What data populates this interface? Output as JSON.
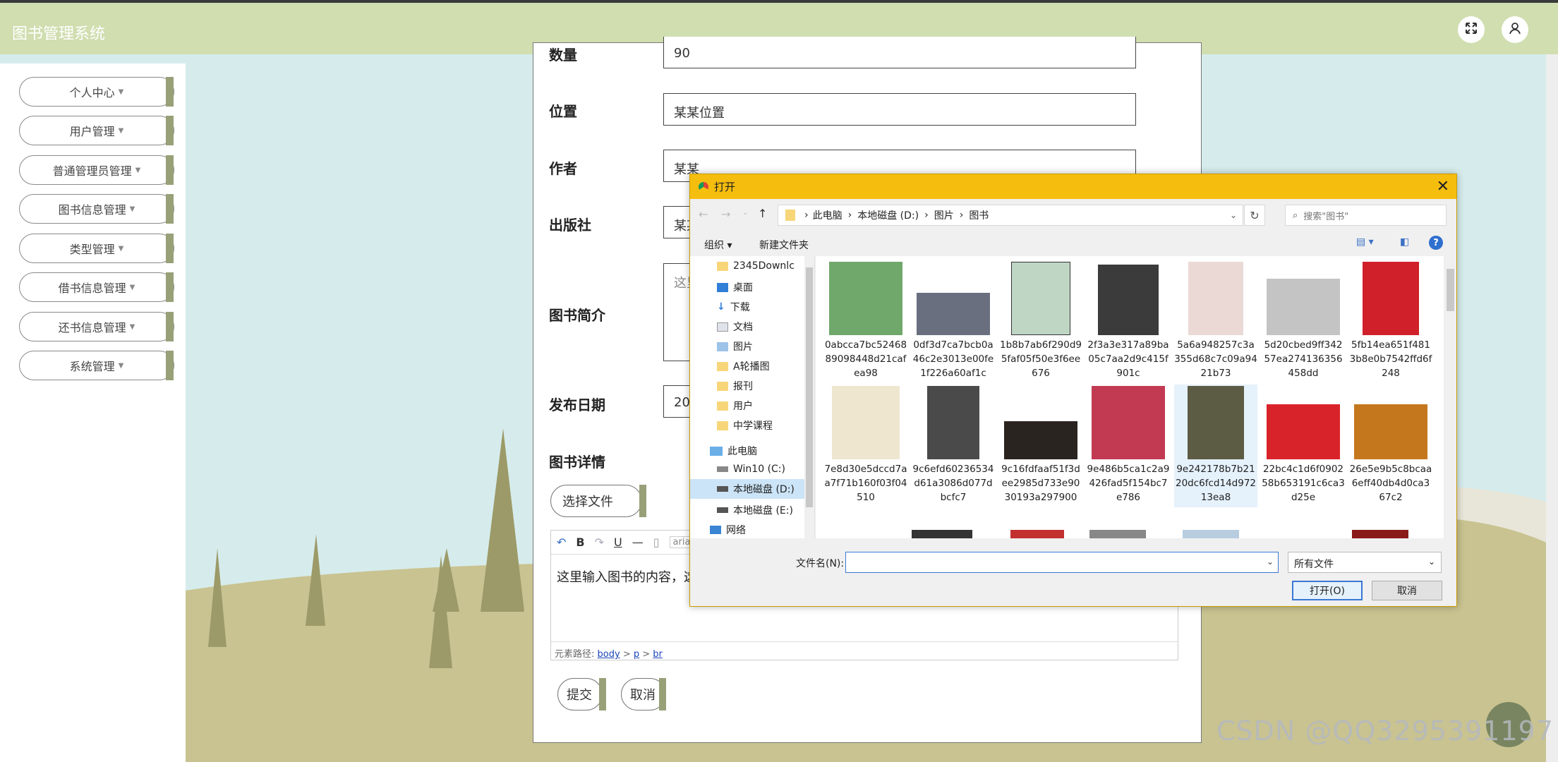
{
  "header": {
    "title": "图书管理系统"
  },
  "sidebar": {
    "items": [
      {
        "label": "个人中心"
      },
      {
        "label": "用户管理"
      },
      {
        "label": "普通管理员管理"
      },
      {
        "label": "图书信息管理"
      },
      {
        "label": "类型管理"
      },
      {
        "label": "借书信息管理"
      },
      {
        "label": "还书信息管理"
      },
      {
        "label": "系统管理"
      }
    ]
  },
  "form": {
    "quantity": {
      "label": "数量",
      "value": "90"
    },
    "location": {
      "label": "位置",
      "value": "某某位置"
    },
    "author": {
      "label": "作者",
      "value": "某某"
    },
    "publisher": {
      "label": "出版社",
      "value": "某某"
    },
    "intro": {
      "label": "图书简介",
      "value": "这里"
    },
    "publish_date": {
      "label": "发布日期",
      "value": "20"
    },
    "details": {
      "label": "图书详情"
    },
    "choose_file": "选择文件",
    "editor": {
      "font": "aria",
      "content": "这里输入图书的内容，这",
      "path_label": "元素路径:",
      "path": [
        "body",
        "p",
        "br"
      ]
    },
    "submit": "提交",
    "cancel": "取消"
  },
  "dialog": {
    "title": "打开",
    "breadcrumb": [
      "此电脑",
      "本地磁盘 (D:)",
      "图片",
      "图书"
    ],
    "search_placeholder": "搜索\"图书\"",
    "organize": "组织",
    "new_folder": "新建文件夹",
    "nav_items": [
      "2345Downlc",
      "桌面",
      "下载",
      "文档",
      "图片",
      "A轮播图",
      "报刊",
      "用户",
      "中学课程",
      "此电脑",
      "Win10 (C:)",
      "本地磁盘 (D:)",
      "本地磁盘 (E:)",
      "网络"
    ],
    "files": [
      {
        "name": "0abcca7bc5246889098448d21cafea98",
        "color": "#6fa86a"
      },
      {
        "name": "0df3d7ca7bcb0a46c2e3013e00fe1f226a60af1c",
        "color": "#6a6f80"
      },
      {
        "name": "1b8b7ab6f290d95faf05f50e3f6ee676",
        "color": "#bfd6c4"
      },
      {
        "name": "2f3a3e317a89ba05c7aa2d9c415f901c",
        "color": "#3b3b3b"
      },
      {
        "name": "5a6a948257c3a355d68c7c09a9421b73",
        "color": "#ead9d5"
      },
      {
        "name": "5d20cbed9ff34257ea274136356458dd",
        "color": "#c4c4c4"
      },
      {
        "name": "5fb14ea651f4813b8e0b7542ffd6f248",
        "color": "#d0202a"
      },
      {
        "name": "7e8d30e5dccd7aa7f71b160f03f04510",
        "color": "#efe6d0"
      },
      {
        "name": "9c6efd60236534d61a3086d077dbcfc7",
        "color": "#4a4a4a"
      },
      {
        "name": "9c16fdfaaf51f3dee2985d733e9030193a297900",
        "color": "#2a2420"
      },
      {
        "name": "9e486b5ca1c2a9426fad5f154bc7e786",
        "color": "#c23a52"
      },
      {
        "name": "9e242178b7b2120dc6fcd14d97213ea8",
        "color": "#5c5c44"
      },
      {
        "name": "22bc4c1d6f090258b653191c6ca3d25e",
        "color": "#d9232a"
      },
      {
        "name": "26e5e9b5c8bcaa6eff40db4d0ca367c2",
        "color": "#c5771e"
      }
    ],
    "filename_label": "文件名(N):",
    "filetype": "所有文件",
    "open": "打开(O)",
    "cancel": "取消"
  },
  "watermark": "CSDN @QQ3295391197"
}
